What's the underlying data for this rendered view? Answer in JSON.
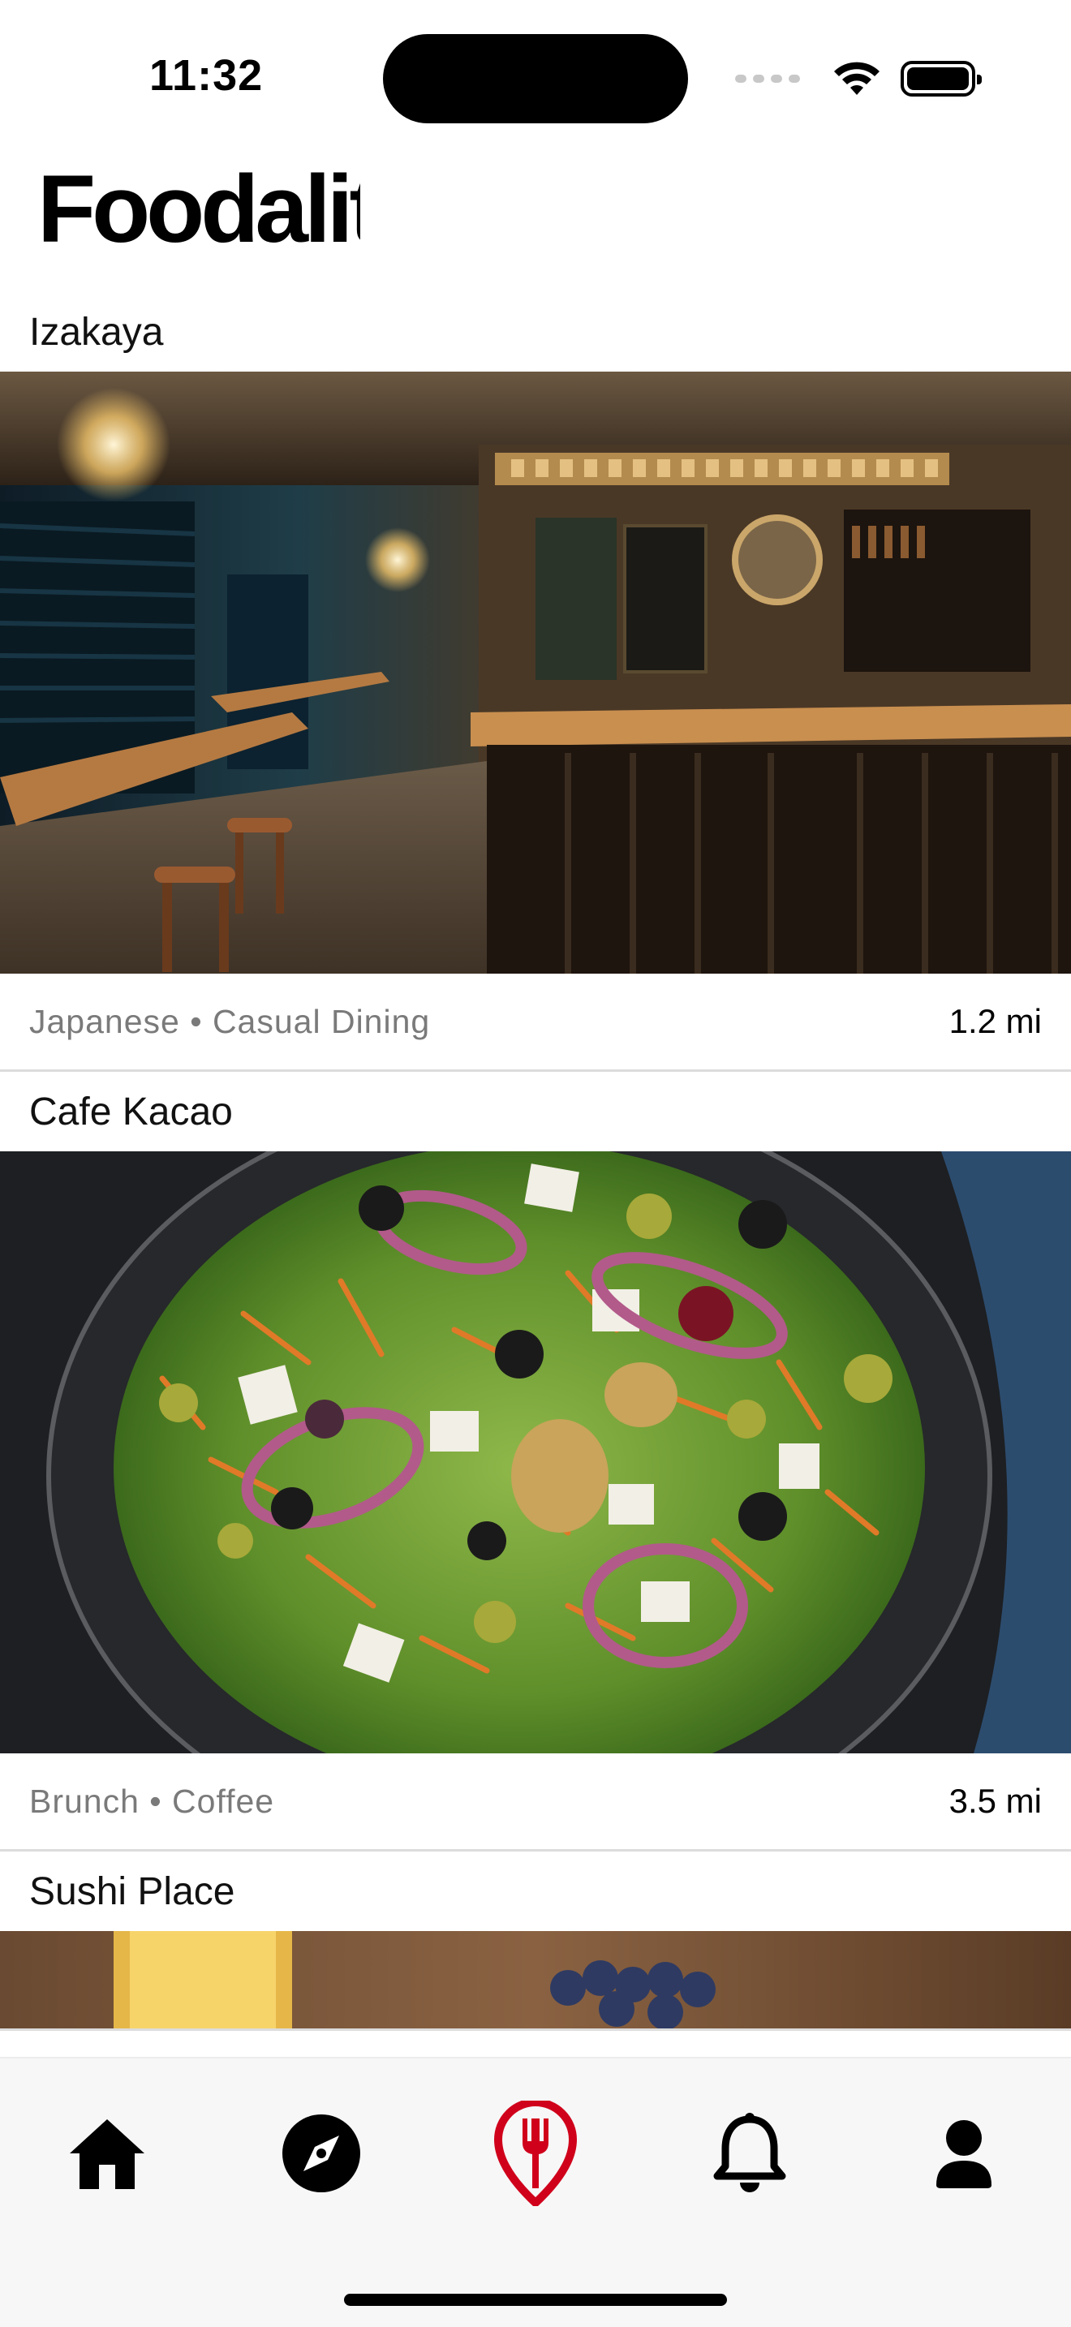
{
  "status_bar": {
    "time": "11:32",
    "icons": [
      "cellular-icon",
      "wifi-icon",
      "battery-icon"
    ]
  },
  "header": {
    "app_name": "Foodality"
  },
  "restaurants": [
    {
      "name": "Izakaya",
      "tags": "Japanese • Casual Dining",
      "distance": "1.2 mi",
      "image": "izakaya-interior-photo"
    },
    {
      "name": "Cafe Kacao",
      "tags": "Brunch • Coffee",
      "distance": "3.5 mi",
      "image": "salad-bowl-photo"
    },
    {
      "name": "Sushi Place",
      "image": "sushi-place-photo"
    }
  ],
  "tab_bar": {
    "items": [
      {
        "icon": "home-icon",
        "active": false
      },
      {
        "icon": "compass-icon",
        "active": false
      },
      {
        "icon": "fork-icon",
        "active": true
      },
      {
        "icon": "bell-icon",
        "active": false
      },
      {
        "icon": "profile-icon",
        "active": false
      }
    ],
    "colors": {
      "active": "#d0021b",
      "inactive": "#000000"
    }
  }
}
